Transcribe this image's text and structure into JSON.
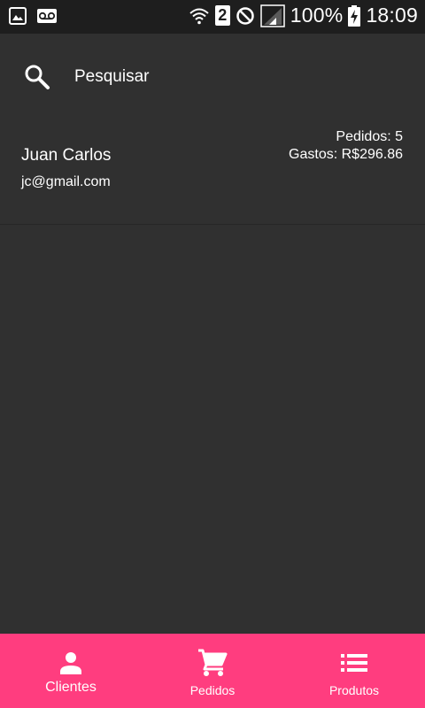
{
  "status_bar": {
    "battery": "100%",
    "time": "18:09",
    "sim_slot": "2",
    "icons": [
      "image-icon",
      "voicemail-icon",
      "wifi-icon",
      "sim-icon",
      "do-not-disturb-icon",
      "signal-icon",
      "battery-charging-icon"
    ]
  },
  "search": {
    "placeholder": "Pesquisar",
    "icon": "search-icon"
  },
  "clients": [
    {
      "name": "Juan Carlos",
      "email": "jc@gmail.com",
      "orders": "Pedidos: 5",
      "spent": "Gastos: R$296.86"
    }
  ],
  "bottom_nav": {
    "active_color": "#ff3d7f",
    "items": [
      {
        "label": "Clientes",
        "icon": "person-icon"
      },
      {
        "label": "Pedidos",
        "icon": "shopping-cart-icon"
      },
      {
        "label": "Produtos",
        "icon": "list-icon"
      }
    ]
  },
  "colors": {
    "background": "#303030",
    "status_bar": "#1e1e1e",
    "accent": "#ff3d7f"
  }
}
